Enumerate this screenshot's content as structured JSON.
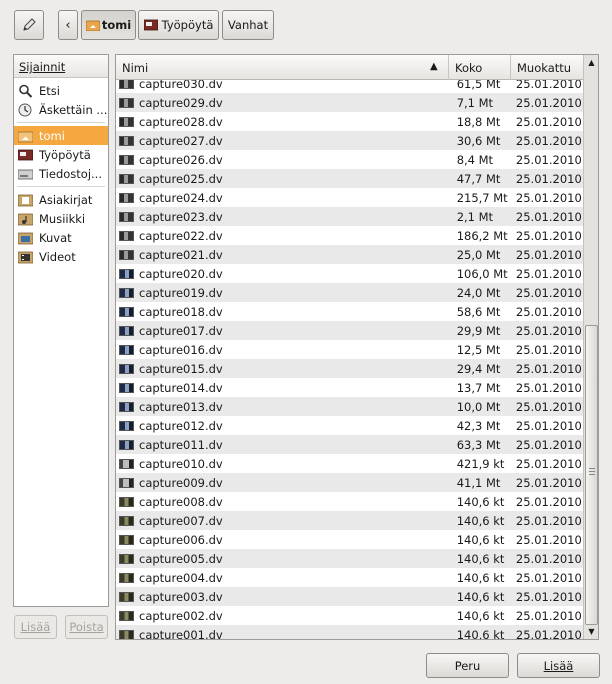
{
  "toolbar": {
    "edit_icon": "pencil-icon",
    "back_icon": "chevron-left-icon",
    "crumbs": [
      {
        "label": "tomi",
        "icon": "home-folder-icon",
        "active": true
      },
      {
        "label": "Työpöytä",
        "icon": "desktop-icon",
        "active": false
      },
      {
        "label": "Vanhat",
        "active": false
      }
    ]
  },
  "places": {
    "header": "Sijainnit",
    "items": [
      {
        "label": "Etsi",
        "icon": "search-icon"
      },
      {
        "label": "Äskettäin ...",
        "icon": "recent-icon"
      },
      {
        "label": "tomi",
        "icon": "home-folder-icon",
        "selected": true
      },
      {
        "label": "Työpöytä",
        "icon": "desktop-icon"
      },
      {
        "label": "Tiedostoj...",
        "icon": "filesystem-icon"
      },
      {
        "label": "Asiakirjat",
        "icon": "documents-folder-icon"
      },
      {
        "label": "Musiikki",
        "icon": "music-folder-icon"
      },
      {
        "label": "Kuvat",
        "icon": "pictures-folder-icon"
      },
      {
        "label": "Videot",
        "icon": "videos-folder-icon"
      }
    ],
    "add_label": "Lisää",
    "remove_label": "Poista"
  },
  "filelist": {
    "columns": {
      "name": "Nimi",
      "size": "Koko",
      "modified": "Muokattu"
    },
    "files": [
      {
        "name": "capture030.dv",
        "size": "61,5 Mt",
        "modified": "25.01.2010"
      },
      {
        "name": "capture029.dv",
        "size": "7,1 Mt",
        "modified": "25.01.2010"
      },
      {
        "name": "capture028.dv",
        "size": "18,8 Mt",
        "modified": "25.01.2010"
      },
      {
        "name": "capture027.dv",
        "size": "30,6 Mt",
        "modified": "25.01.2010"
      },
      {
        "name": "capture026.dv",
        "size": "8,4 Mt",
        "modified": "25.01.2010"
      },
      {
        "name": "capture025.dv",
        "size": "47,7 Mt",
        "modified": "25.01.2010"
      },
      {
        "name": "capture024.dv",
        "size": "215,7 Mt",
        "modified": "25.01.2010"
      },
      {
        "name": "capture023.dv",
        "size": "2,1 Mt",
        "modified": "25.01.2010"
      },
      {
        "name": "capture022.dv",
        "size": "186,2 Mt",
        "modified": "25.01.2010"
      },
      {
        "name": "capture021.dv",
        "size": "25,0 Mt",
        "modified": "25.01.2010"
      },
      {
        "name": "capture020.dv",
        "size": "106,0 Mt",
        "modified": "25.01.2010"
      },
      {
        "name": "capture019.dv",
        "size": "24,0 Mt",
        "modified": "25.01.2010"
      },
      {
        "name": "capture018.dv",
        "size": "58,6 Mt",
        "modified": "25.01.2010"
      },
      {
        "name": "capture017.dv",
        "size": "29,9 Mt",
        "modified": "25.01.2010"
      },
      {
        "name": "capture016.dv",
        "size": "12,5 Mt",
        "modified": "25.01.2010"
      },
      {
        "name": "capture015.dv",
        "size": "29,4 Mt",
        "modified": "25.01.2010"
      },
      {
        "name": "capture014.dv",
        "size": "13,7 Mt",
        "modified": "25.01.2010"
      },
      {
        "name": "capture013.dv",
        "size": "10,0 Mt",
        "modified": "25.01.2010"
      },
      {
        "name": "capture012.dv",
        "size": "42,3 Mt",
        "modified": "25.01.2010"
      },
      {
        "name": "capture011.dv",
        "size": "63,3 Mt",
        "modified": "25.01.2010"
      },
      {
        "name": "capture010.dv",
        "size": "421,9 kt",
        "modified": "25.01.2010"
      },
      {
        "name": "capture009.dv",
        "size": "41,1 Mt",
        "modified": "25.01.2010"
      },
      {
        "name": "capture008.dv",
        "size": "140,6 kt",
        "modified": "25.01.2010"
      },
      {
        "name": "capture007.dv",
        "size": "140,6 kt",
        "modified": "25.01.2010"
      },
      {
        "name": "capture006.dv",
        "size": "140,6 kt",
        "modified": "25.01.2010"
      },
      {
        "name": "capture005.dv",
        "size": "140,6 kt",
        "modified": "25.01.2010"
      },
      {
        "name": "capture004.dv",
        "size": "140,6 kt",
        "modified": "25.01.2010"
      },
      {
        "name": "capture003.dv",
        "size": "140,6 kt",
        "modified": "25.01.2010"
      },
      {
        "name": "capture002.dv",
        "size": "140,6 kt",
        "modified": "25.01.2010"
      },
      {
        "name": "capture001.dv",
        "size": "140,6 kt",
        "modified": "25.01.2010"
      }
    ]
  },
  "dialog": {
    "cancel_label": "Peru",
    "add_label": "Lisää"
  },
  "colors": {
    "selection": "#f4a83f",
    "row_alt": "#e9e9e9",
    "background": "#edeceb"
  }
}
